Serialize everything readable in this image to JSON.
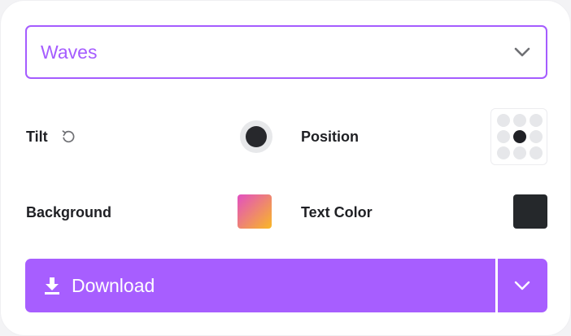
{
  "pattern_select": {
    "value": "Waves",
    "icon": "chevron-down-icon"
  },
  "tilt": {
    "label": "Tilt",
    "reset_icon": "reset-icon"
  },
  "position": {
    "label": "Position",
    "selected": "center"
  },
  "background": {
    "label": "Background",
    "gradient_from": "#e24fc2",
    "gradient_to": "#f9b825"
  },
  "text_color": {
    "label": "Text Color",
    "value": "#25282b"
  },
  "download": {
    "label": "Download",
    "icon": "download-icon",
    "menu_icon": "chevron-down-icon"
  },
  "colors": {
    "accent": "#a75eff"
  }
}
